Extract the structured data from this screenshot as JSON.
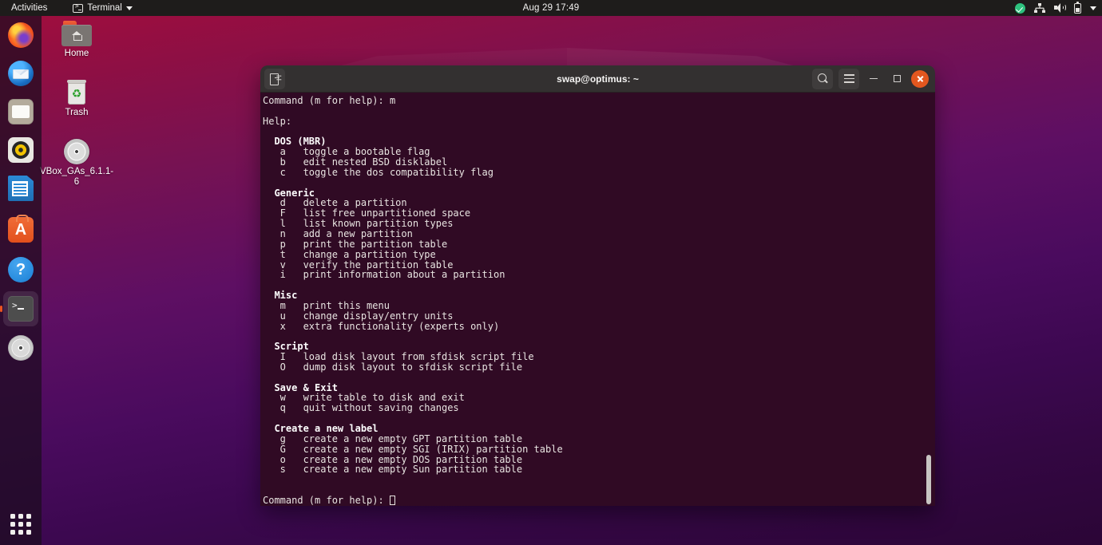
{
  "topbar": {
    "activities": "Activities",
    "app_menu_label": "Terminal",
    "app_menu_icon": "terminal-icon",
    "clock": "Aug 29  17:49",
    "tray": [
      {
        "name": "shield-check-icon",
        "color": "#2ec27e"
      },
      {
        "name": "network-icon"
      },
      {
        "name": "volume-icon"
      },
      {
        "name": "battery-icon"
      },
      {
        "name": "chevron-down-icon"
      }
    ],
    "background": "#1e1c1b"
  },
  "dock": {
    "background": "rgba(28,12,30,0.72)",
    "items": [
      {
        "name": "firefox",
        "label": "Firefox",
        "icon": "firefox-icon",
        "active": false
      },
      {
        "name": "thunderbird",
        "label": "Thunderbird Mail",
        "icon": "thunderbird-icon",
        "active": false
      },
      {
        "name": "files",
        "label": "Files",
        "icon": "folder-icon",
        "active": false
      },
      {
        "name": "rhythmbox",
        "label": "Rhythmbox",
        "icon": "music-player-icon",
        "active": false
      },
      {
        "name": "libreoffice-writer",
        "label": "LibreOffice Writer",
        "icon": "document-icon",
        "active": false
      },
      {
        "name": "ubuntu-software",
        "label": "Ubuntu Software",
        "icon": "software-bag-icon",
        "active": false
      },
      {
        "name": "help",
        "label": "Help",
        "icon": "question-mark-icon",
        "active": false
      },
      {
        "name": "terminal",
        "label": "Terminal",
        "icon": "terminal-icon",
        "active": true
      },
      {
        "name": "disc",
        "label": "VBox_GAs_6.1.1-6",
        "icon": "optical-disc-icon",
        "active": false
      }
    ],
    "show_applications": {
      "label": "Show Applications",
      "icon": "app-grid-icon"
    }
  },
  "desktop_icons": [
    {
      "name": "home-folder",
      "label": "Home",
      "icon": "home-folder-icon"
    },
    {
      "name": "trash",
      "label": "Trash",
      "icon": "trash-icon"
    },
    {
      "name": "vbox-guest-additions",
      "label": "VBox_GAs_6.1.1-6",
      "label_line1": "VBox_GAs_6.1.1-",
      "label_line2": "6",
      "icon": "optical-disc-icon"
    }
  ],
  "terminal": {
    "title": "swap@optimus: ~",
    "background": "#300a24",
    "foreground": "#e8e4e1",
    "titlebar_background": "#333030",
    "close_button_color": "#e2571f",
    "titlebar_buttons": [
      {
        "name": "new-tab-button",
        "icon": "new-tab-icon"
      },
      {
        "name": "search-button",
        "icon": "search-icon"
      },
      {
        "name": "hamburger-menu-button",
        "icon": "hamburger-menu-icon"
      },
      {
        "name": "minimize-button",
        "icon": "minimize-icon"
      },
      {
        "name": "maximize-button",
        "icon": "maximize-icon"
      },
      {
        "name": "close-button",
        "icon": "close-icon"
      }
    ],
    "prompt_top": "Command (m for help): m",
    "help_label": "Help:",
    "prompt_bottom": "Command (m for help): ",
    "sections": [
      {
        "heading": "DOS (MBR)",
        "entries": [
          {
            "key": "a",
            "desc": "toggle a bootable flag"
          },
          {
            "key": "b",
            "desc": "edit nested BSD disklabel"
          },
          {
            "key": "c",
            "desc": "toggle the dos compatibility flag"
          }
        ]
      },
      {
        "heading": "Generic",
        "entries": [
          {
            "key": "d",
            "desc": "delete a partition"
          },
          {
            "key": "F",
            "desc": "list free unpartitioned space"
          },
          {
            "key": "l",
            "desc": "list known partition types"
          },
          {
            "key": "n",
            "desc": "add a new partition"
          },
          {
            "key": "p",
            "desc": "print the partition table"
          },
          {
            "key": "t",
            "desc": "change a partition type"
          },
          {
            "key": "v",
            "desc": "verify the partition table"
          },
          {
            "key": "i",
            "desc": "print information about a partition"
          }
        ]
      },
      {
        "heading": "Misc",
        "entries": [
          {
            "key": "m",
            "desc": "print this menu"
          },
          {
            "key": "u",
            "desc": "change display/entry units"
          },
          {
            "key": "x",
            "desc": "extra functionality (experts only)"
          }
        ]
      },
      {
        "heading": "Script",
        "entries": [
          {
            "key": "I",
            "desc": "load disk layout from sfdisk script file"
          },
          {
            "key": "O",
            "desc": "dump disk layout to sfdisk script file"
          }
        ]
      },
      {
        "heading": "Save & Exit",
        "entries": [
          {
            "key": "w",
            "desc": "write table to disk and exit"
          },
          {
            "key": "q",
            "desc": "quit without saving changes"
          }
        ]
      },
      {
        "heading": "Create a new label",
        "entries": [
          {
            "key": "g",
            "desc": "create a new empty GPT partition table"
          },
          {
            "key": "G",
            "desc": "create a new empty SGI (IRIX) partition table"
          },
          {
            "key": "o",
            "desc": "create a new empty DOS partition table"
          },
          {
            "key": "s",
            "desc": "create a new empty Sun partition table"
          }
        ]
      }
    ]
  }
}
